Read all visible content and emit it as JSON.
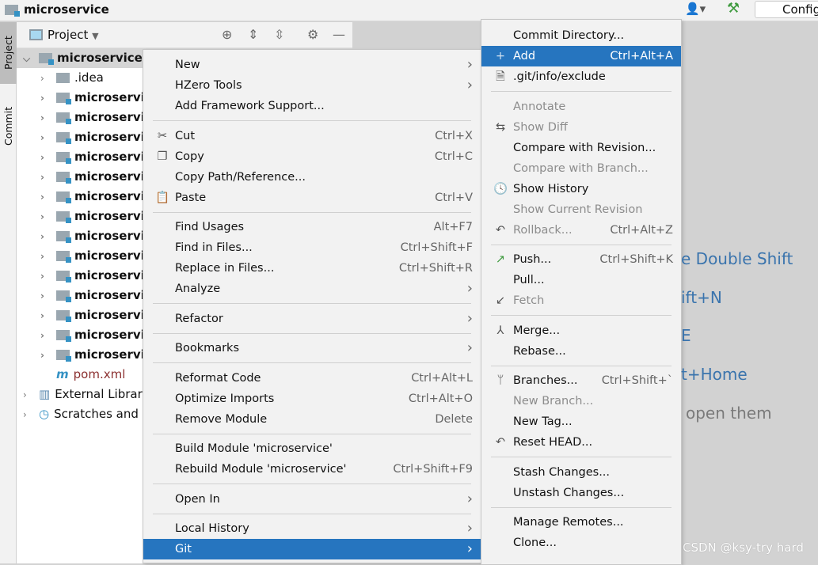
{
  "window": {
    "title": "microservice",
    "config_label": "Config"
  },
  "sidebar_tabs": {
    "project": "Project",
    "commit": "Commit"
  },
  "project_panel": {
    "title": "Project"
  },
  "tree": [
    {
      "label": "microservice",
      "bold": true,
      "expanded": true,
      "indent": 0,
      "icon": "module-folder"
    },
    {
      "label": ".idea",
      "bold": false,
      "indent": 1,
      "icon": "folder"
    },
    {
      "label": "microservice",
      "bold": true,
      "indent": 1,
      "icon": "module-folder"
    },
    {
      "label": "microservice",
      "bold": true,
      "indent": 1,
      "icon": "module-folder"
    },
    {
      "label": "microservice",
      "bold": true,
      "indent": 1,
      "icon": "module-folder"
    },
    {
      "label": "microservice",
      "bold": true,
      "indent": 1,
      "icon": "module-folder"
    },
    {
      "label": "microservice",
      "bold": true,
      "indent": 1,
      "icon": "module-folder"
    },
    {
      "label": "microservice",
      "bold": true,
      "indent": 1,
      "icon": "module-folder"
    },
    {
      "label": "microservice",
      "bold": true,
      "indent": 1,
      "icon": "module-folder"
    },
    {
      "label": "microservice",
      "bold": true,
      "indent": 1,
      "icon": "module-folder"
    },
    {
      "label": "microservice",
      "bold": true,
      "indent": 1,
      "icon": "module-folder"
    },
    {
      "label": "microservice",
      "bold": true,
      "indent": 1,
      "icon": "module-folder"
    },
    {
      "label": "microservice",
      "bold": true,
      "indent": 1,
      "icon": "module-folder"
    },
    {
      "label": "microservice",
      "bold": true,
      "indent": 1,
      "icon": "module-folder"
    },
    {
      "label": "microservice",
      "bold": true,
      "indent": 1,
      "icon": "module-folder"
    },
    {
      "label": "microservice",
      "bold": true,
      "indent": 1,
      "icon": "module-folder"
    },
    {
      "label": "pom.xml",
      "bold": false,
      "indent": 1,
      "icon": "maven-file",
      "leaf": true,
      "color": "#8b2f2f"
    },
    {
      "label": "External Libraries",
      "bold": false,
      "indent": 0,
      "icon": "libraries"
    },
    {
      "label": "Scratches and Consoles",
      "bold": false,
      "indent": 0,
      "icon": "scratches"
    }
  ],
  "editor_hints": [
    "e Double Shift",
    "ift+N",
    "E",
    "t+Home",
    "open them"
  ],
  "watermark": "CSDN @ksy-try hard",
  "context_menu": [
    {
      "label": "New",
      "submenu": true
    },
    {
      "label": "HZero Tools",
      "submenu": true
    },
    {
      "label": "Add Framework Support..."
    },
    {
      "sep": true
    },
    {
      "label": "Cut",
      "shortcut": "Ctrl+X",
      "icon": "scissors"
    },
    {
      "label": "Copy",
      "shortcut": "Ctrl+C",
      "icon": "copy"
    },
    {
      "label": "Copy Path/Reference..."
    },
    {
      "label": "Paste",
      "shortcut": "Ctrl+V",
      "icon": "clipboard"
    },
    {
      "sep": true
    },
    {
      "label": "Find Usages",
      "shortcut": "Alt+F7"
    },
    {
      "label": "Find in Files...",
      "shortcut": "Ctrl+Shift+F"
    },
    {
      "label": "Replace in Files...",
      "shortcut": "Ctrl+Shift+R"
    },
    {
      "label": "Analyze",
      "submenu": true
    },
    {
      "sep": true
    },
    {
      "label": "Refactor",
      "submenu": true
    },
    {
      "sep": true
    },
    {
      "label": "Bookmarks",
      "submenu": true
    },
    {
      "sep": true
    },
    {
      "label": "Reformat Code",
      "shortcut": "Ctrl+Alt+L"
    },
    {
      "label": "Optimize Imports",
      "shortcut": "Ctrl+Alt+O"
    },
    {
      "label": "Remove Module",
      "shortcut": "Delete"
    },
    {
      "sep": true
    },
    {
      "label": "Build Module 'microservice'"
    },
    {
      "label": "Rebuild Module 'microservice'",
      "shortcut": "Ctrl+Shift+F9"
    },
    {
      "sep": true
    },
    {
      "label": "Open In",
      "submenu": true
    },
    {
      "sep": true
    },
    {
      "label": "Local History",
      "submenu": true
    },
    {
      "label": "Git",
      "submenu": true,
      "selected": true
    }
  ],
  "git_menu": [
    {
      "label": "Commit Directory..."
    },
    {
      "label": "Add",
      "shortcut": "Ctrl+Alt+A",
      "icon": "plus",
      "selected": true
    },
    {
      "label": ".git/info/exclude",
      "icon": "ignore-file"
    },
    {
      "sep": true
    },
    {
      "label": "Annotate",
      "disabled": true
    },
    {
      "label": "Show Diff",
      "disabled": true,
      "icon": "diff"
    },
    {
      "label": "Compare with Revision..."
    },
    {
      "label": "Compare with Branch...",
      "disabled": true
    },
    {
      "label": "Show History",
      "icon": "clock"
    },
    {
      "label": "Show Current Revision",
      "disabled": true
    },
    {
      "label": "Rollback...",
      "shortcut": "Ctrl+Alt+Z",
      "disabled": true,
      "icon": "undo"
    },
    {
      "sep": true
    },
    {
      "label": "Push...",
      "shortcut": "Ctrl+Shift+K",
      "icon": "push-arrow"
    },
    {
      "label": "Pull..."
    },
    {
      "label": "Fetch",
      "disabled": true,
      "icon": "fetch"
    },
    {
      "sep": true
    },
    {
      "label": "Merge...",
      "icon": "merge"
    },
    {
      "label": "Rebase..."
    },
    {
      "sep": true
    },
    {
      "label": "Branches...",
      "shortcut": "Ctrl+Shift+`",
      "icon": "branch"
    },
    {
      "label": "New Branch...",
      "disabled": true
    },
    {
      "label": "New Tag..."
    },
    {
      "label": "Reset HEAD...",
      "icon": "undo"
    },
    {
      "sep": true
    },
    {
      "label": "Stash Changes..."
    },
    {
      "label": "Unstash Changes..."
    },
    {
      "sep": true
    },
    {
      "label": "Manage Remotes..."
    },
    {
      "label": "Clone..."
    }
  ],
  "colors": {
    "selection": "#2675bf",
    "menu_bg": "#f2f2f2",
    "hint_link": "#3a74ad"
  }
}
